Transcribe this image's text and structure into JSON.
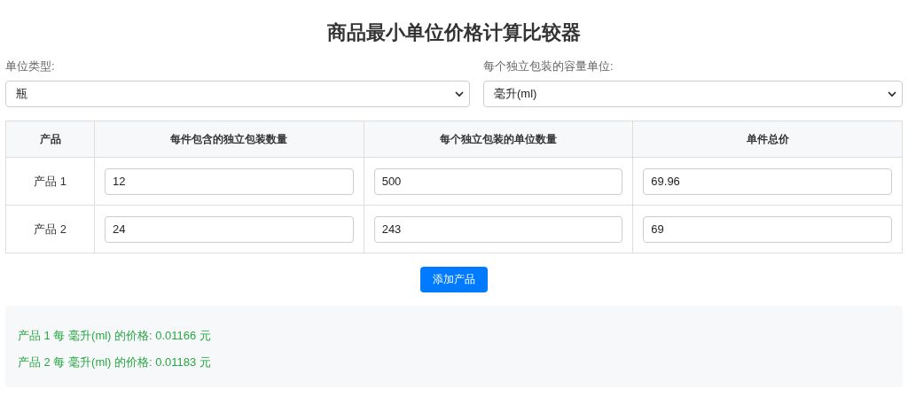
{
  "title": "商品最小单位价格计算比较器",
  "selectors": [
    {
      "label": "单位类型:",
      "value": "瓶"
    },
    {
      "label": "每个独立包装的容量单位:",
      "value": "毫升(ml)"
    }
  ],
  "table": {
    "columns": [
      "产品",
      "每件包含的独立包装数量",
      "每个独立包装的单位数量",
      "单件总价"
    ],
    "rows": [
      {
        "name": "产品 1",
        "values": [
          "12",
          "500",
          "69.96"
        ]
      },
      {
        "name": "产品 2",
        "values": [
          "24",
          "243",
          "69"
        ]
      }
    ]
  },
  "add_button": "添加产品",
  "results": [
    "产品 1 每 毫升(ml) 的价格: 0.01166 元",
    "产品 2 每 毫升(ml) 的价格: 0.01183 元"
  ]
}
